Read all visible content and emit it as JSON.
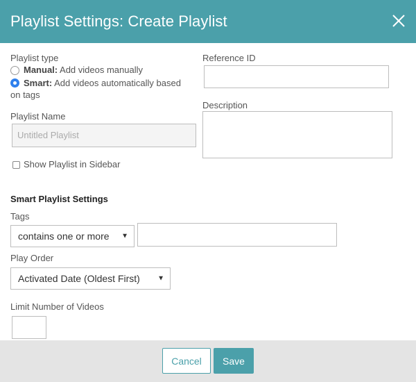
{
  "header": {
    "title": "Playlist Settings: Create Playlist"
  },
  "playlist_type": {
    "label": "Playlist type",
    "options": [
      {
        "bold": "Manual:",
        "desc": "Add videos manually",
        "checked": false
      },
      {
        "bold": "Smart:",
        "desc": "Add videos automatically based",
        "desc2": "on tags",
        "checked": true
      }
    ]
  },
  "reference_id": {
    "label": "Reference ID",
    "value": ""
  },
  "description": {
    "label": "Description",
    "value": ""
  },
  "playlist_name": {
    "label": "Playlist Name",
    "placeholder": "Untitled Playlist"
  },
  "sidebar": {
    "label": "Show Playlist in Sidebar",
    "checked": false
  },
  "smart_settings": {
    "title": "Smart Playlist Settings",
    "tags_label": "Tags",
    "tags_operator": "contains one or more",
    "tags_value": "",
    "play_order_label": "Play Order",
    "play_order": "Activated Date (Oldest First)",
    "limit_label": "Limit Number of Videos",
    "limit_value": ""
  },
  "footer": {
    "cancel": "Cancel",
    "save": "Save"
  },
  "colors": {
    "accent": "#4ba0aa",
    "radio_checked": "#2f80ed"
  }
}
